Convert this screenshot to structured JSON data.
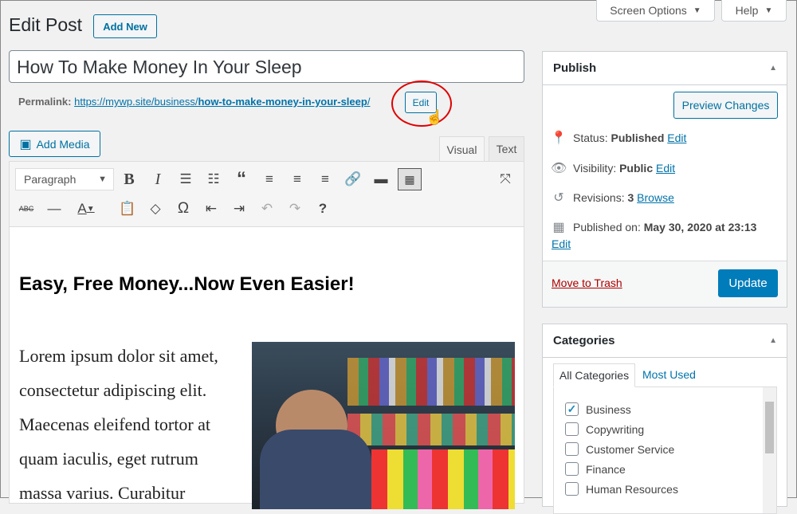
{
  "header": {
    "title": "Edit Post",
    "add_new": "Add New",
    "screen_options": "Screen Options",
    "help": "Help"
  },
  "post": {
    "title": "How To Make Money In Your Sleep",
    "permalink_label": "Permalink:",
    "permalink_base": "https://mywp.site/business/",
    "permalink_slug": "how-to-make-money-in-your-sleep",
    "permalink_end": "/",
    "permalink_edit": "Edit"
  },
  "editor": {
    "add_media": "Add Media",
    "tabs": [
      "Visual",
      "Text"
    ],
    "active_tab": "Visual",
    "format_select": "Paragraph",
    "toolbar1": [
      "bold-icon",
      "italic-icon",
      "bulleted-list-icon",
      "numbered-list-icon",
      "blockquote-icon",
      "align-left-icon",
      "align-center-icon",
      "align-right-icon",
      "link-icon",
      "read-more-icon",
      "toolbar-toggle-icon"
    ],
    "toolbar2": [
      "strikethrough-icon",
      "horizontal-line-icon",
      "text-color-icon",
      "paste-text-icon",
      "clear-formatting-icon",
      "special-character-icon",
      "outdent-icon",
      "indent-icon",
      "undo-icon",
      "redo-icon",
      "help-icon"
    ],
    "heading": "Easy, Free Money...Now Even Easier!",
    "paragraph_lines": [
      "Lorem ipsum dolor sit amet,",
      "consectetur adipiscing elit.",
      "Maecenas eleifend tortor at",
      "quam iaculis, eget rutrum",
      "massa varius. Curabitur"
    ]
  },
  "publish": {
    "title": "Publish",
    "preview": "Preview Changes",
    "status_label": "Status:",
    "status": "Published",
    "visibility_label": "Visibility:",
    "visibility": "Public",
    "revisions_label": "Revisions:",
    "revisions": "3",
    "browse": "Browse",
    "published_label": "Published on:",
    "published_date": "May 30, 2020 at 23:13",
    "edit": "Edit",
    "trash": "Move to Trash",
    "update": "Update"
  },
  "categories": {
    "title": "Categories",
    "tabs": [
      "All Categories",
      "Most Used"
    ],
    "items": [
      {
        "label": "Business",
        "checked": true
      },
      {
        "label": "Copywriting",
        "checked": false
      },
      {
        "label": "Customer Service",
        "checked": false
      },
      {
        "label": "Finance",
        "checked": false
      },
      {
        "label": "Human Resources",
        "checked": false
      }
    ]
  },
  "colors": {
    "accent": "#0073aa",
    "primary_button": "#007cba",
    "trash": "#a00",
    "highlight_circle": "#e00000"
  }
}
